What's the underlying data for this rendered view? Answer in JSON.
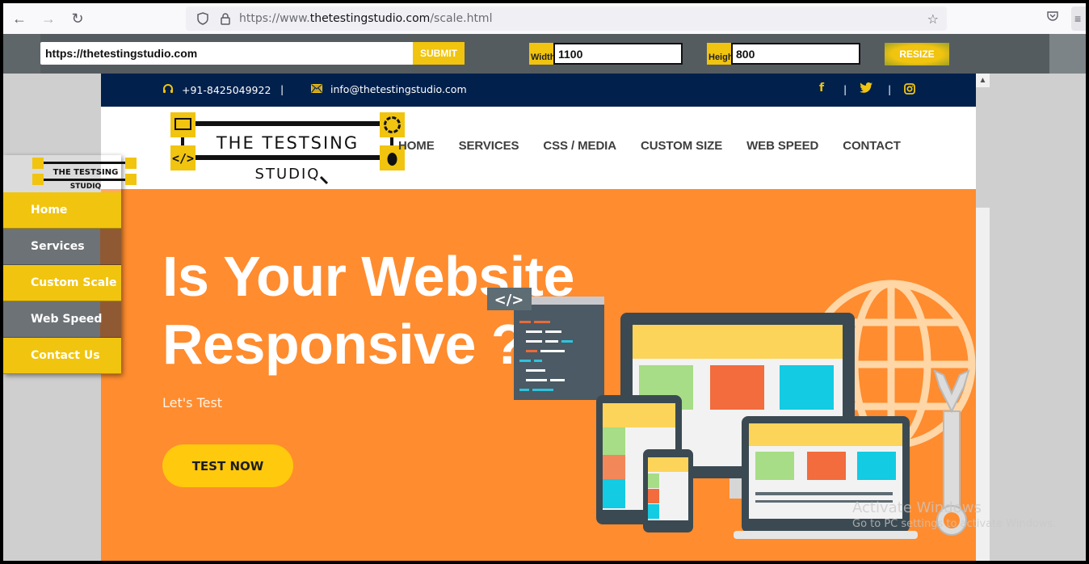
{
  "browser": {
    "url_prefix": "https://www.",
    "url_domain": "thetestingstudio.com",
    "url_path": "/scale.html",
    "icons": [
      "back-icon",
      "forward-icon",
      "reload-icon",
      "shield-icon",
      "lock-icon",
      "bookmark-star-icon",
      "pocket-icon",
      "menu-icon"
    ]
  },
  "toolbar": {
    "url_value": "https://thetestingstudio.com",
    "submit_label": "SUBMIT",
    "width_label": "Width",
    "width_value": "1100",
    "height_label": "Height",
    "height_value": "800",
    "resize_label": "RESIZE"
  },
  "site": {
    "topbar": {
      "phone": "+91-8425049922",
      "separator": "|",
      "email": "info@thetestingstudio.com",
      "social": [
        "facebook",
        "twitter",
        "instagram"
      ]
    },
    "logo": {
      "line1": "THE TESTSING",
      "line2": "STUDIQ"
    },
    "nav": [
      {
        "label": "HOME"
      },
      {
        "label": "SERVICES"
      },
      {
        "label": "CSS / MEDIA"
      },
      {
        "label": "CUSTOM SIZE"
      },
      {
        "label": "WEB SPEED"
      },
      {
        "label": "CONTACT"
      }
    ],
    "hero": {
      "title_line1": "Is Your Website",
      "title_line2": "Responsive ?",
      "subtitle": "Let's Test",
      "cta_label": "TEST NOW",
      "code_tag": "</>"
    }
  },
  "sidebar": {
    "logo_line1": "THE TESTSING",
    "logo_line2": "STUDIQ",
    "items": [
      {
        "label": "Home"
      },
      {
        "label": "Services"
      },
      {
        "label": "Custom Scale"
      },
      {
        "label": "Web Speed"
      },
      {
        "label": "Contact Us"
      }
    ]
  },
  "watermark": {
    "line1": "Activate Windows",
    "line2": "Go to PC settings to activate Windows."
  },
  "colors": {
    "accent_yellow": "#f1c40f",
    "topbar_navy": "#01204c",
    "hero_orange": "#ff8c2f",
    "toolbar_gray": "#555c60"
  }
}
